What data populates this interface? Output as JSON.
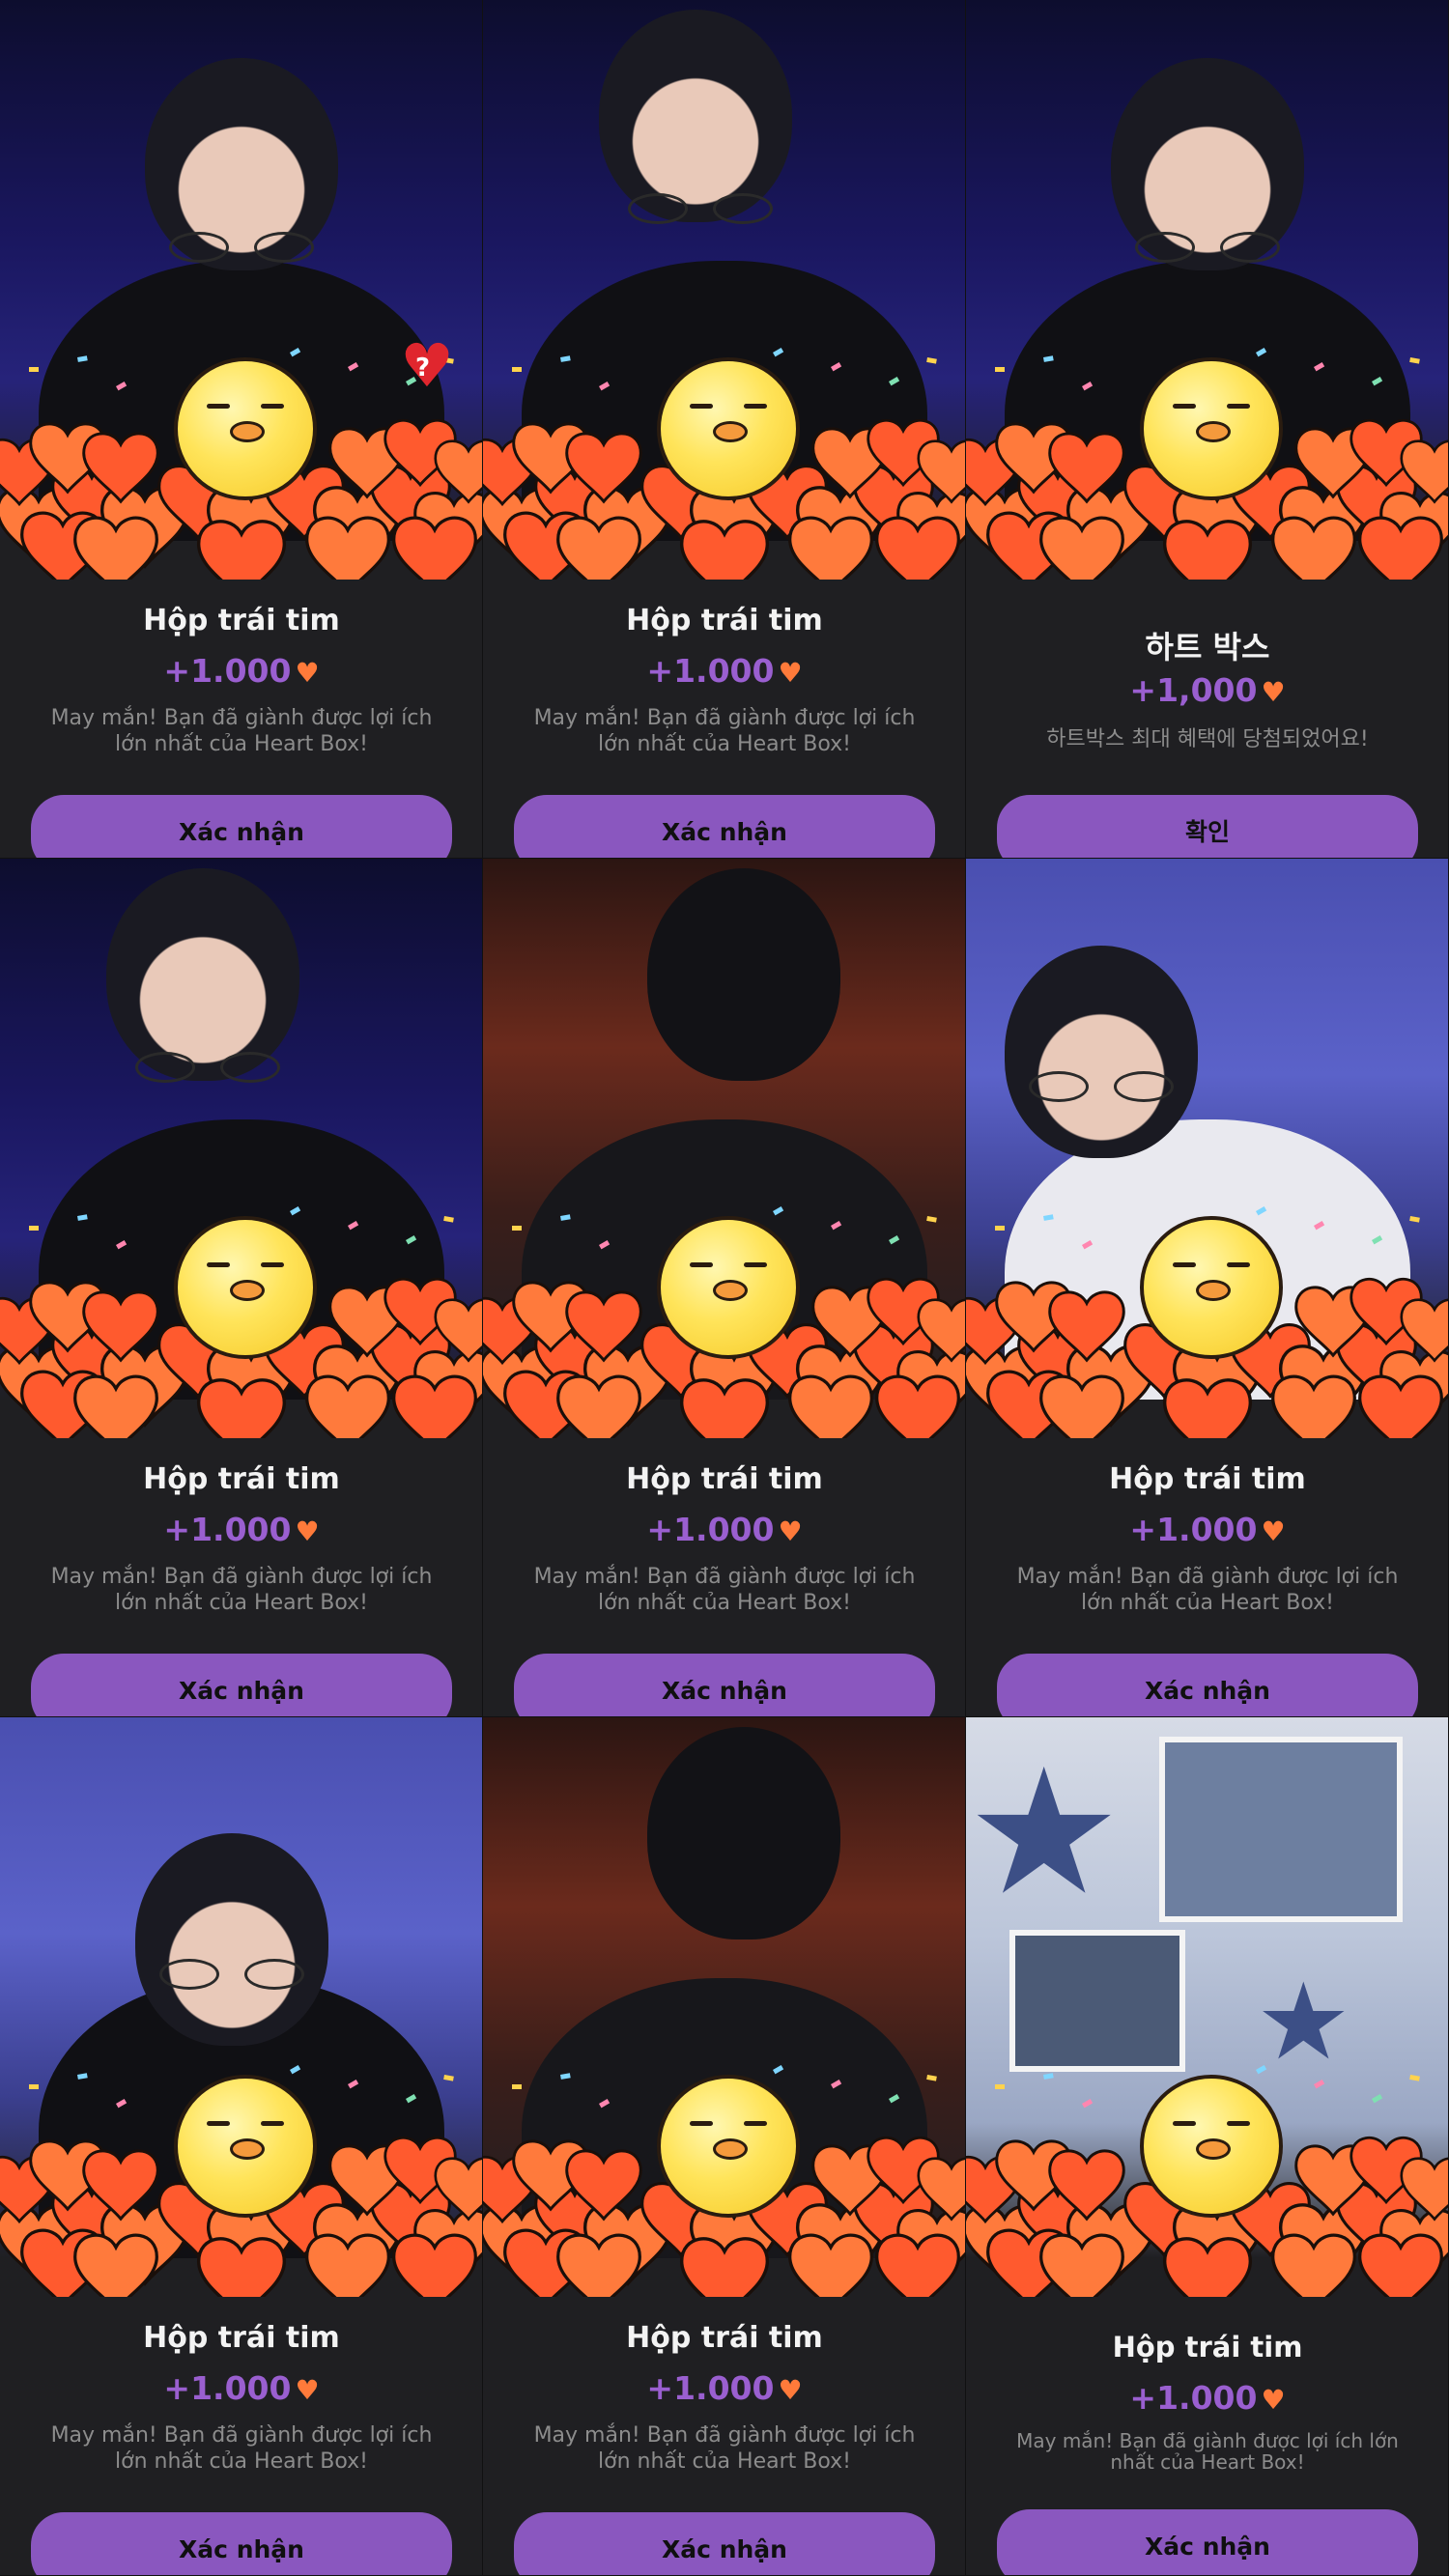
{
  "cards": [
    {
      "title": "Hộp trái tim",
      "amount": "+1.000",
      "heart_icon": "heart",
      "message": "May mắn! Bạn đã giành được lợi ích lớn nhất của Heart Box!",
      "button_label": "Xác nhận",
      "badge": "?"
    },
    {
      "title": "Hộp trái tim",
      "amount": "+1.000",
      "heart_icon": "heart",
      "message": "May mắn! Bạn đã giành được lợi ích lớn nhất của Heart Box!",
      "button_label": "Xác nhận"
    },
    {
      "title": "하트 박스",
      "amount": "+1,000",
      "heart_icon": "heart",
      "message": "하트박스 최대 혜택에 당첨되었어요!",
      "button_label": "확인"
    },
    {
      "title": "Hộp trái tim",
      "amount": "+1.000",
      "heart_icon": "heart",
      "message": "May mắn! Bạn đã giành được lợi ích lớn nhất của Heart Box!",
      "button_label": "Xác nhận"
    },
    {
      "title": "Hộp trái tim",
      "amount": "+1.000",
      "heart_icon": "heart",
      "message": "May mắn! Bạn đã giành được lợi ích lớn nhất của Heart Box!",
      "button_label": "Xác nhận"
    },
    {
      "title": "Hộp trái tim",
      "amount": "+1.000",
      "heart_icon": "heart",
      "message": "May mắn! Bạn đã giành được lợi ích lớn nhất của Heart Box!",
      "button_label": "Xác nhận"
    },
    {
      "title": "Hộp trái tim",
      "amount": "+1.000",
      "heart_icon": "heart",
      "message": "May mắn! Bạn đã giành được lợi ích lớn nhất của Heart Box!",
      "button_label": "Xác nhận"
    },
    {
      "title": "Hộp trái tim",
      "amount": "+1.000",
      "heart_icon": "heart",
      "message": "May mắn! Bạn đã giành được lợi ích lớn nhất của Heart Box!",
      "button_label": "Xác nhận"
    },
    {
      "title": "Hộp trái tim",
      "amount": "+1.000",
      "heart_icon": "heart",
      "message": "May mắn! Bạn đã giành được lợi ích lớn nhất của Heart Box!",
      "button_label": "Xác nhận"
    }
  ],
  "colors": {
    "accent": "#8a57bf",
    "amount_text": "#9a5fd0",
    "heart": "#ff7a3a",
    "card_bg": "#1f1f22"
  }
}
